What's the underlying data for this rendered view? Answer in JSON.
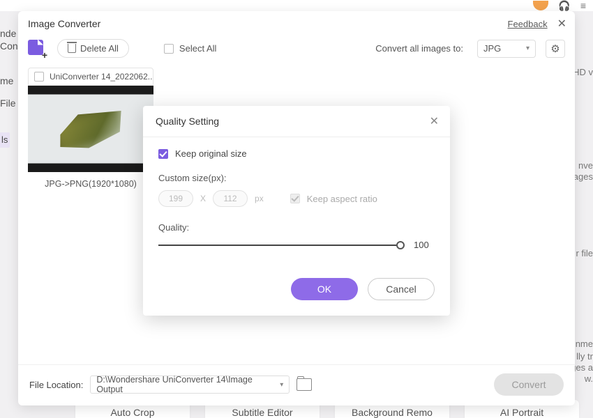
{
  "bg": {
    "side1": "nde",
    "side2": "Con",
    "side3": "me",
    "side4": "File",
    "tools": "ls",
    "right1": "HD v",
    "right2": "nve",
    "right3": "ages",
    "right4": "r file",
    "right5": "nme",
    "right6": "lly tr",
    "right7": "ges a",
    "right8": "w.",
    "cards": [
      "Auto Crop",
      "Subtitle Editor",
      "Background Remo",
      "AI Portrait"
    ]
  },
  "window": {
    "title": "Image Converter",
    "feedback": "Feedback",
    "toolbar": {
      "delete_all": "Delete All",
      "select_all": "Select All",
      "convert_to_label": "Convert all images to:",
      "format": "JPG"
    },
    "thumb": {
      "filename": "UniConverter 14_2022062...",
      "caption": "JPG->PNG(1920*1080)"
    },
    "bottom": {
      "file_location_label": "File Location:",
      "path": "D:\\Wondershare UniConverter 14\\Image Output",
      "convert": "Convert"
    }
  },
  "modal": {
    "title": "Quality Setting",
    "keep_original": "Keep original size",
    "custom_size_label": "Custom size(px):",
    "width": "199",
    "height": "112",
    "px": "px",
    "keep_ratio": "Keep aspect ratio",
    "quality_label": "Quality:",
    "quality_value": "100",
    "ok": "OK",
    "cancel": "Cancel"
  }
}
